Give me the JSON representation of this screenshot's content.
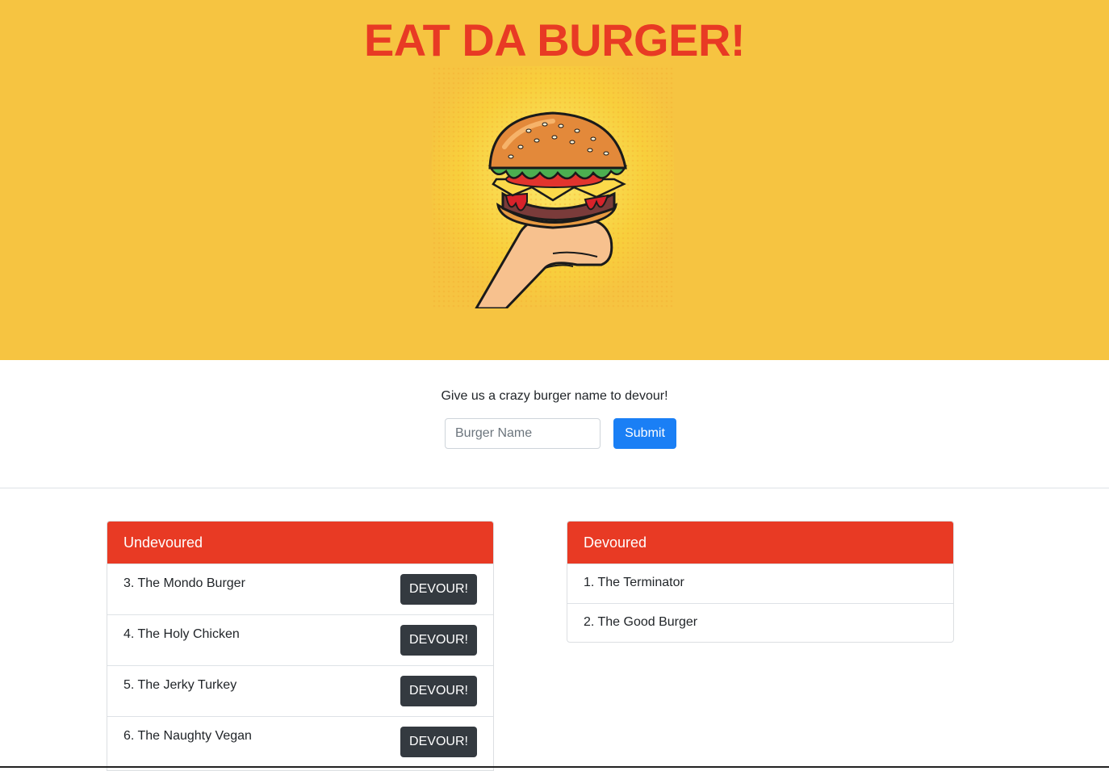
{
  "hero": {
    "title": "EAT DA BURGER!",
    "image": "burger-in-hand-illustration"
  },
  "form": {
    "prompt": "Give us a crazy burger name to devour!",
    "input_placeholder": "Burger Name",
    "input_value": "",
    "submit_label": "Submit"
  },
  "undevoured": {
    "header": "Undevoured",
    "items": [
      {
        "label": "3. The Mondo Burger",
        "button": "DEVOUR!"
      },
      {
        "label": "4. The Holy Chicken",
        "button": "DEVOUR!"
      },
      {
        "label": "5. The Jerky Turkey",
        "button": "DEVOUR!"
      },
      {
        "label": "6. The Naughty Vegan",
        "button": "DEVOUR!"
      }
    ]
  },
  "devoured": {
    "header": "Devoured",
    "items": [
      {
        "label": "1. The Terminator"
      },
      {
        "label": "2. The Good Burger"
      }
    ]
  },
  "colors": {
    "hero_bg": "#f6c441",
    "title": "#e83a24",
    "card_header": "#e83a24",
    "submit": "#1a7ff5",
    "devour_button": "#343a40"
  }
}
